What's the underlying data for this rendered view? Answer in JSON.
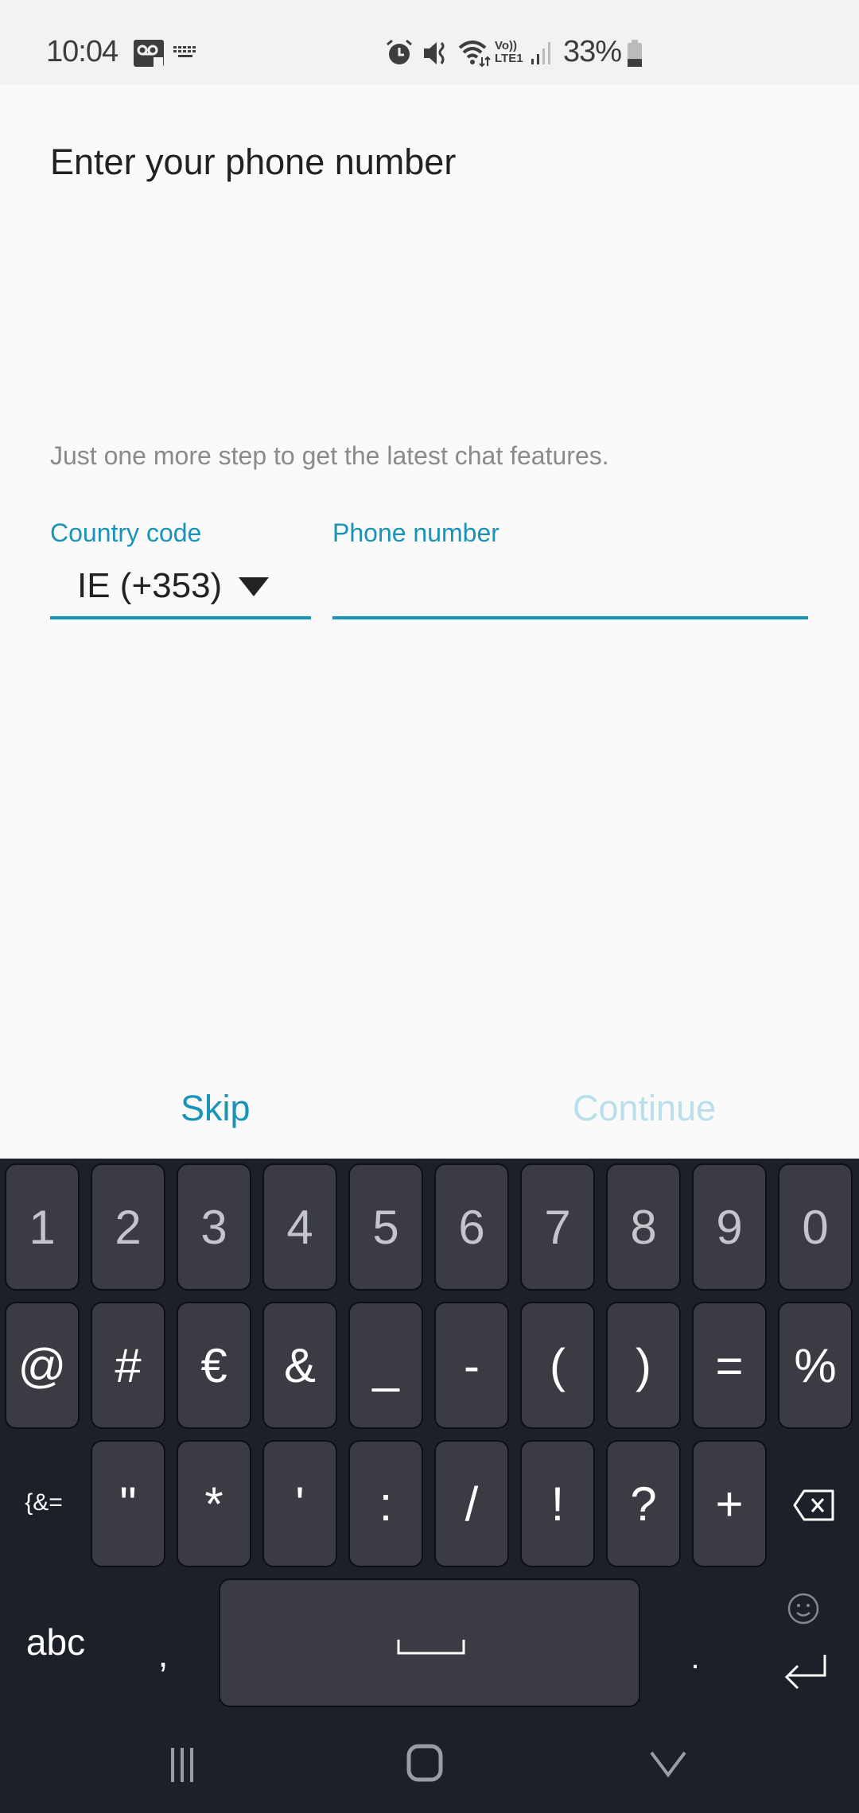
{
  "status_bar": {
    "time": "10:04",
    "left_icons": [
      "voicemail-icon",
      "keyboard-icon"
    ],
    "right_icons": [
      "alarm-icon",
      "mute-icon",
      "wifi-icon",
      "volte-lte-icon",
      "signal-icon"
    ],
    "volte_label_top": "Vo))",
    "volte_label_bottom": "LTE1",
    "battery_percent": "33%",
    "battery_level": 0.33
  },
  "page": {
    "title": "Enter your phone number",
    "subtitle": "Just one more step to get the latest chat features.",
    "country_code": {
      "label": "Country code",
      "value": "IE (+353)"
    },
    "phone_number": {
      "label": "Phone number",
      "value": "",
      "placeholder": ""
    }
  },
  "actions": {
    "skip_label": "Skip",
    "continue_label": "Continue"
  },
  "colors": {
    "accent": "#1a93b8",
    "disabled": "#b8dfeb",
    "keyboard_bg": "#1e2029",
    "key_bg": "#3a3b43"
  },
  "keyboard": {
    "row1": [
      "1",
      "2",
      "3",
      "4",
      "5",
      "6",
      "7",
      "8",
      "9",
      "0"
    ],
    "row2": [
      "@",
      "#",
      "€",
      "&",
      "_",
      "-",
      "(",
      ")",
      "=",
      "%"
    ],
    "row3_toggle": "{&=",
    "row3": [
      "\"",
      "*",
      "'",
      ":",
      "/",
      "!",
      "?",
      "+"
    ],
    "abc_label": "abc",
    "comma": ",",
    "period": ".",
    "space_glyph": "␣"
  },
  "nav_bar": {
    "buttons": [
      "recent-apps",
      "home",
      "hide-keyboard"
    ]
  }
}
